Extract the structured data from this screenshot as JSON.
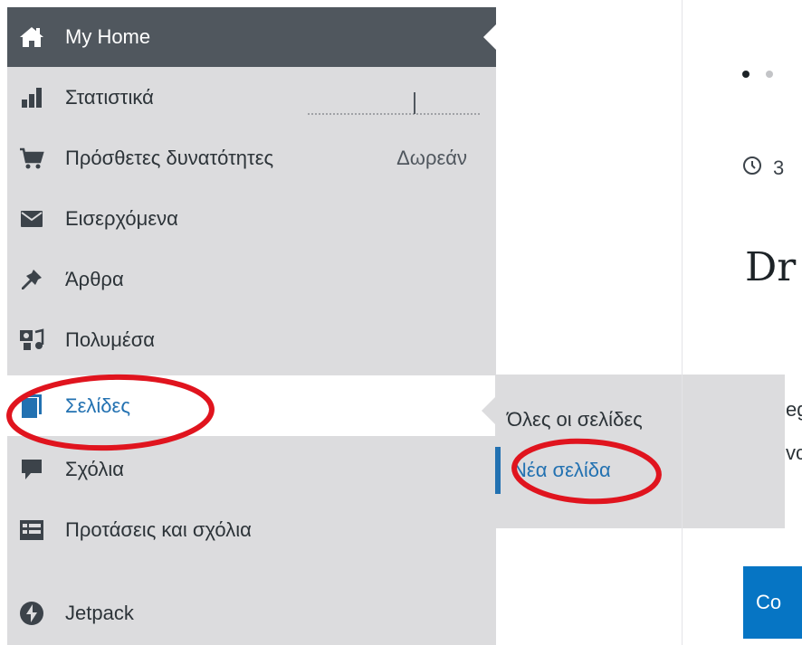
{
  "sidebar": {
    "items": [
      {
        "label": "My Home",
        "icon": "home-icon"
      },
      {
        "label": "Στατιστικά",
        "icon": "stats-bars-icon"
      },
      {
        "label": "Πρόσθετες δυνατότητες",
        "icon": "cart-icon",
        "tag": "Δωρεάν"
      },
      {
        "label": "Εισερχόμενα",
        "icon": "mail-icon"
      },
      {
        "label": "Άρθρα",
        "icon": "pin-icon"
      },
      {
        "label": "Πολυμέσα",
        "icon": "media-icon"
      },
      {
        "label": "Σελίδες",
        "icon": "pages-icon"
      },
      {
        "label": "Σχόλια",
        "icon": "comment-icon"
      },
      {
        "label": "Προτάσεις και σχόλια",
        "icon": "feedback-icon"
      },
      {
        "label": "Jetpack",
        "icon": "jetpack-icon"
      }
    ]
  },
  "flyout": {
    "items": [
      {
        "label": "Όλες οι σελίδες"
      },
      {
        "label": "Νέα σελίδα"
      }
    ]
  },
  "content": {
    "clock_text": "3",
    "headline": "Dr",
    "line1": "eg",
    "line2": "vc",
    "button_label": "Co"
  },
  "colors": {
    "sidebar_bg": "#dcdcde",
    "home_bg": "#50575e",
    "accent": "#2271b1",
    "button_bg": "#0675c4",
    "annotation": "#e0141e"
  }
}
